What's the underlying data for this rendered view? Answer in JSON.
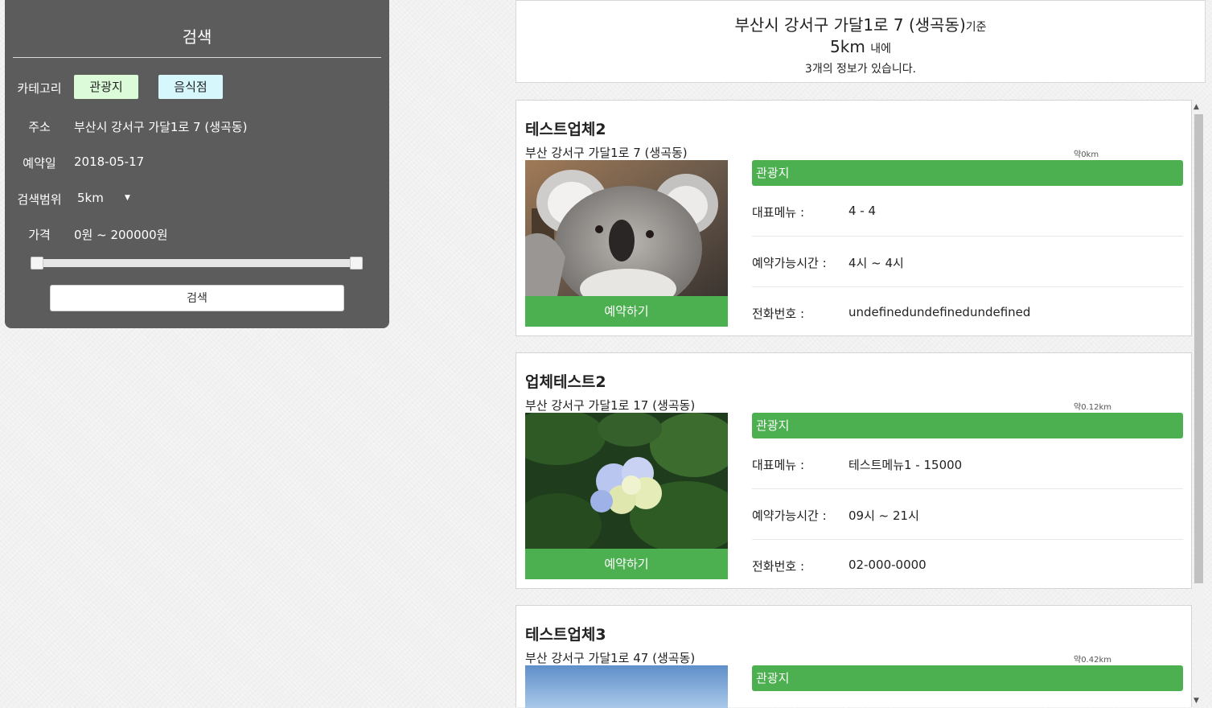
{
  "search_panel": {
    "title": "검색",
    "category_label": "카테고리",
    "category_tour": "관광지",
    "category_food": "음식점",
    "address_label": "주소",
    "address_value": "부산시 강서구 가달1로 7 (생곡동)",
    "date_label": "예약일",
    "date_value": "2018-05-17",
    "range_label": "검색범위",
    "range_value": "5km",
    "price_label": "가격",
    "price_value": "0원  ~ 200000원",
    "price_slider": {
      "min": 0,
      "max": 200000
    },
    "search_button": "검색"
  },
  "summary": {
    "address": "부산시 강서구 가달1로 7 (생곡동)",
    "address_suffix": "기준",
    "distance": "5km",
    "distance_suffix": "내에",
    "count_text": "3개의 정보가 있습니다."
  },
  "results": [
    {
      "name": "테스트업체2",
      "address": "부산 강서구 가달1로 7 (생곡동)",
      "distance": "약0km",
      "category": "관광지",
      "reserve_label": "예약하기",
      "menu_label": "대표메뉴 :",
      "menu_value": "4 - 4",
      "hours_label": "예약가능시간 :",
      "hours_value": "4시 ~ 4시",
      "phone_label": "전화번호 :",
      "phone_value": "undefinedundefinedundefined"
    },
    {
      "name": "업체테스트2",
      "address": "부산 강서구 가달1로 17 (생곡동)",
      "distance": "약0.12km",
      "category": "관광지",
      "reserve_label": "예약하기",
      "menu_label": "대표메뉴 :",
      "menu_value": "테스트메뉴1 - 15000",
      "hours_label": "예약가능시간 :",
      "hours_value": "09시 ~ 21시",
      "phone_label": "전화번호 :",
      "phone_value": "02-000-0000"
    },
    {
      "name": "테스트업체3",
      "address": "부산 강서구 가달1로 47 (생곡동)",
      "distance": "약0.42km",
      "category": "관광지"
    }
  ],
  "colors": {
    "panel_bg": "#5c5c5c",
    "accent_green": "#4caf50",
    "tour_button_bg": "#dcfcd9",
    "food_button_bg": "#d6f7fc"
  },
  "icons": {
    "dropdown": "caret-down-icon",
    "scroll_up": "scroll-up-arrow-icon",
    "scroll_down": "scroll-down-arrow-icon"
  }
}
